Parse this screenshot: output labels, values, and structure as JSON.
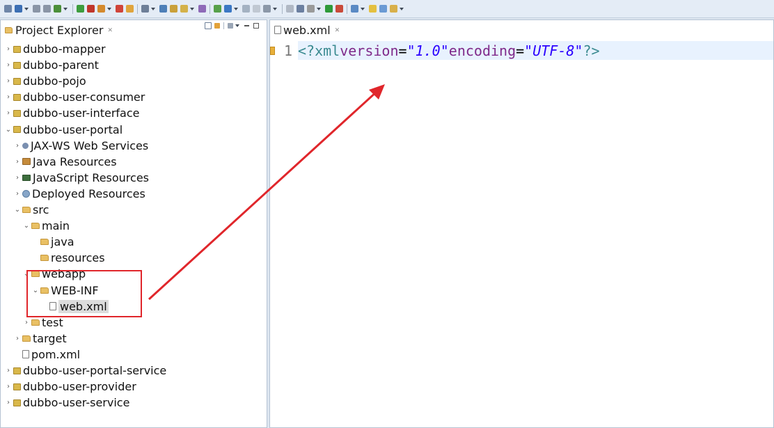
{
  "explorer": {
    "title": "Project Explorer",
    "tree": [
      {
        "label": "dubbo-mapper",
        "depth": 0,
        "twisty": "›",
        "icon": "project-icon"
      },
      {
        "label": "dubbo-parent",
        "depth": 0,
        "twisty": "›",
        "icon": "project-icon"
      },
      {
        "label": "dubbo-pojo",
        "depth": 0,
        "twisty": "›",
        "icon": "project-icon"
      },
      {
        "label": "dubbo-user-consumer",
        "depth": 0,
        "twisty": "›",
        "icon": "project-icon"
      },
      {
        "label": "dubbo-user-interface",
        "depth": 0,
        "twisty": "›",
        "icon": "project-icon"
      },
      {
        "label": "dubbo-user-portal",
        "depth": 0,
        "twisty": "⌄",
        "icon": "project-icon"
      },
      {
        "label": "JAX-WS Web Services",
        "depth": 1,
        "twisty": "›",
        "icon": "webservice-icon"
      },
      {
        "label": "Java Resources",
        "depth": 1,
        "twisty": "›",
        "icon": "java-resources-icon"
      },
      {
        "label": "JavaScript Resources",
        "depth": 1,
        "twisty": "›",
        "icon": "javascript-icon"
      },
      {
        "label": "Deployed Resources",
        "depth": 1,
        "twisty": "›",
        "icon": "deployed-icon"
      },
      {
        "label": "src",
        "depth": 1,
        "twisty": "⌄",
        "icon": "folder-icon"
      },
      {
        "label": "main",
        "depth": 2,
        "twisty": "⌄",
        "icon": "folder-icon"
      },
      {
        "label": "java",
        "depth": 3,
        "twisty": "",
        "icon": "folder-icon"
      },
      {
        "label": "resources",
        "depth": 3,
        "twisty": "",
        "icon": "folder-icon"
      },
      {
        "label": "webapp",
        "depth": 2,
        "twisty": "⌄",
        "icon": "folder-icon"
      },
      {
        "label": "WEB-INF",
        "depth": 3,
        "twisty": "⌄",
        "icon": "folder-icon"
      },
      {
        "label": "web.xml",
        "depth": 4,
        "twisty": "",
        "icon": "xml-file-icon",
        "selected": true
      },
      {
        "label": "test",
        "depth": 2,
        "twisty": "›",
        "icon": "folder-icon"
      },
      {
        "label": "target",
        "depth": 1,
        "twisty": "›",
        "icon": "folder-icon"
      },
      {
        "label": "pom.xml",
        "depth": 1,
        "twisty": "",
        "icon": "xml-file-icon"
      },
      {
        "label": "dubbo-user-portal-service",
        "depth": 0,
        "twisty": "›",
        "icon": "project-icon"
      },
      {
        "label": "dubbo-user-provider",
        "depth": 0,
        "twisty": "›",
        "icon": "project-icon"
      },
      {
        "label": "dubbo-user-service",
        "depth": 0,
        "twisty": "›",
        "icon": "project-icon"
      }
    ]
  },
  "editor": {
    "tab_title": "web.xml",
    "line_number": "1",
    "code": {
      "pi_open": "<?xml",
      "attr_version": "version",
      "eq": "=",
      "val_version": "\"1.0\"",
      "attr_encoding": "encoding",
      "val_encoding": "\"UTF-8\"",
      "pi_close": "?>"
    }
  },
  "annotation": {
    "color": "#e0262b"
  }
}
